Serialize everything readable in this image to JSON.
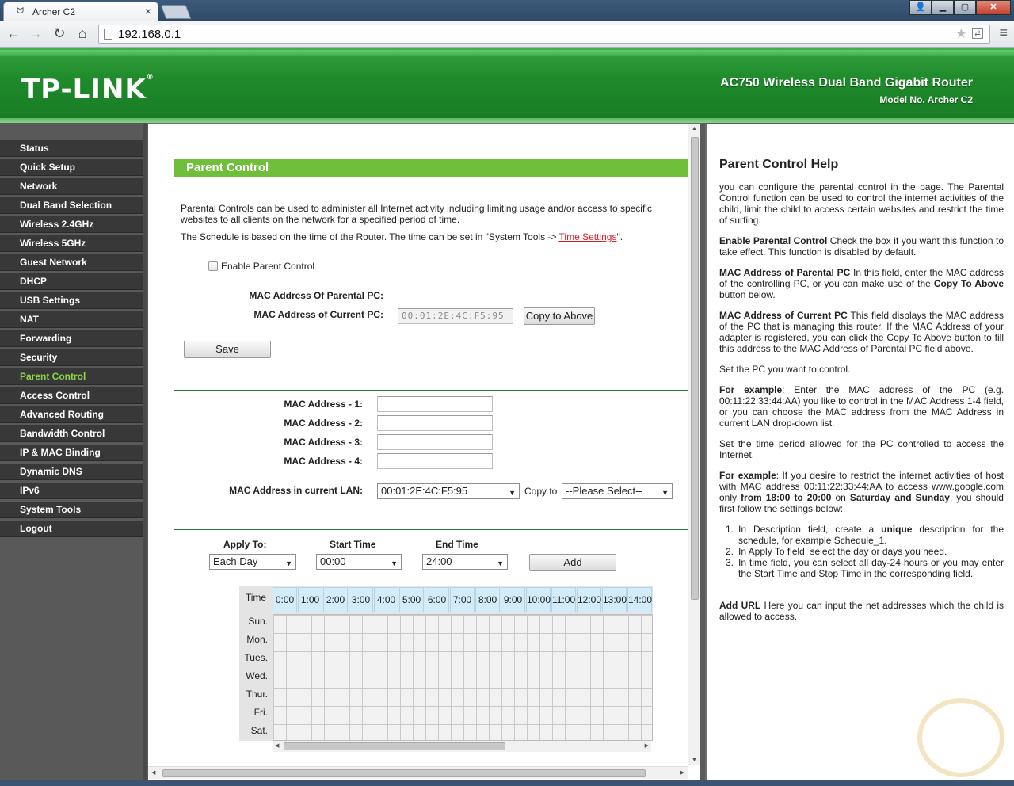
{
  "browser": {
    "tab_title": "Archer C2",
    "tab_close": "×",
    "url": "192.168.0.1",
    "window_buttons": [
      "👤",
      "▁",
      "▢",
      "✕"
    ]
  },
  "header": {
    "logo": "TP-LINK",
    "logo_mark": "®",
    "product": "AC750 Wireless Dual Band Gigabit Router",
    "model": "Model No. Archer C2"
  },
  "sidebar": {
    "items": [
      {
        "label": "Status"
      },
      {
        "label": "Quick Setup"
      },
      {
        "label": "Network"
      },
      {
        "label": "Dual Band Selection"
      },
      {
        "label": "Wireless 2.4GHz"
      },
      {
        "label": "Wireless 5GHz"
      },
      {
        "label": "Guest Network"
      },
      {
        "label": "DHCP"
      },
      {
        "label": "USB Settings"
      },
      {
        "label": "NAT"
      },
      {
        "label": "Forwarding"
      },
      {
        "label": "Security"
      },
      {
        "label": "Parent Control"
      },
      {
        "label": "Access Control"
      },
      {
        "label": "Advanced Routing"
      },
      {
        "label": "Bandwidth Control"
      },
      {
        "label": "IP & MAC Binding"
      },
      {
        "label": "Dynamic DNS"
      },
      {
        "label": "IPv6"
      },
      {
        "label": "System Tools"
      },
      {
        "label": "Logout"
      }
    ],
    "active": "Parent Control"
  },
  "main": {
    "title": "Parent Control",
    "desc1": "Parental Controls can be used to administer all Internet activity including limiting usage and/or access to specific websites to all clients on the network for a specified period of time.",
    "desc2_prefix": "The Schedule is based on the time of the Router. The time can be set in \"System Tools -> ",
    "desc2_link": "Time Settings",
    "desc2_suffix": "\".",
    "enable_label": "Enable Parent Control",
    "mac_parental_label": "MAC Address Of Parental PC:",
    "mac_parental_value": "",
    "mac_current_label": "MAC Address of Current PC:",
    "mac_current_value": "00:01:2E:4C:F5:95",
    "copy_above": "Copy to Above",
    "save": "Save",
    "mac_fields": [
      {
        "label": "MAC Address - 1:",
        "value": ""
      },
      {
        "label": "MAC Address - 2:",
        "value": ""
      },
      {
        "label": "MAC Address - 3:",
        "value": ""
      },
      {
        "label": "MAC Address - 4:",
        "value": ""
      }
    ],
    "lan_label": "MAC Address in current LAN:",
    "lan_value": "00:01:2E:4C:F5:95",
    "copy_to_label": "Copy to",
    "copy_to_value": "--Please Select--",
    "apply_to_label": "Apply To:",
    "apply_to_value": "Each Day",
    "start_label": "Start Time",
    "start_value": "00:00",
    "end_label": "End Time",
    "end_value": "24:00",
    "add": "Add"
  },
  "schedule": {
    "time_header": "Time",
    "hours": [
      "0:00",
      "1:00",
      "2:00",
      "3:00",
      "4:00",
      "5:00",
      "6:00",
      "7:00",
      "8:00",
      "9:00",
      "10:00",
      "11:00",
      "12:00",
      "13:00",
      "14:00"
    ],
    "days": [
      "Sun.",
      "Mon.",
      "Tues.",
      "Wed.",
      "Thur.",
      "Fri.",
      "Sat."
    ]
  },
  "help": {
    "title": "Parent Control Help",
    "intro": "you can configure the parental control in the page. The Parental Control function can be used to control the internet activities of the child, limit the child to access certain websites and restrict the time of surfing.",
    "p1_term": "Enable Parental Control",
    "p1_text": " Check the box if you want this function to take effect. This function is disabled by default.",
    "p2_term": "MAC Address of Parental PC",
    "p2_text": " In this field, enter the MAC address of the controlling PC, or you can make use of the ",
    "p2_term2": "Copy To Above",
    "p2_text2": " button below.",
    "p3_term": "MAC Address of Current PC",
    "p3_text": " This field displays the MAC address of the PC that is managing this router. If the MAC Address of your adapter is registered, you can click the Copy To Above button to fill this address to the MAC Address of Parental PC field above.",
    "p4": "Set the PC you want to control.",
    "p5_term": "For example",
    "p5_text": ": Enter the MAC address of the PC (e.g. 00:11:22:33:44:AA) you like to control in the MAC Address 1-4 field, or you can choose the MAC address from the MAC Address in current LAN drop-down list.",
    "p6": "Set the time period allowed for the PC controlled to access the Internet.",
    "p7_term": "For example",
    "p7_text1": ": If you desire to restrict the internet activities of host with MAC address 00:11:22:33:44:AA to access www.google.com only ",
    "p7_from": "from 18:00 to 20:00",
    "p7_text2": " on ",
    "p7_days": "Saturday and Sunday",
    "p7_text3": ", you should first follow the settings below:",
    "list": [
      {
        "num": "1.",
        "pre": "In Description field, create a ",
        "bold": "unique",
        "post": " description for the schedule, for example Schedule_1."
      },
      {
        "num": "2.",
        "pre": "In Apply To field, select the day or days you need.",
        "bold": "",
        "post": ""
      },
      {
        "num": "3.",
        "pre": "In time field, you can select all day-24 hours or you may enter the Start Time and Stop Time in the corresponding field.",
        "bold": "",
        "post": ""
      }
    ],
    "p8_term": "Add URL",
    "p8_text": " Here you can input the net addresses which the child is allowed to access."
  }
}
